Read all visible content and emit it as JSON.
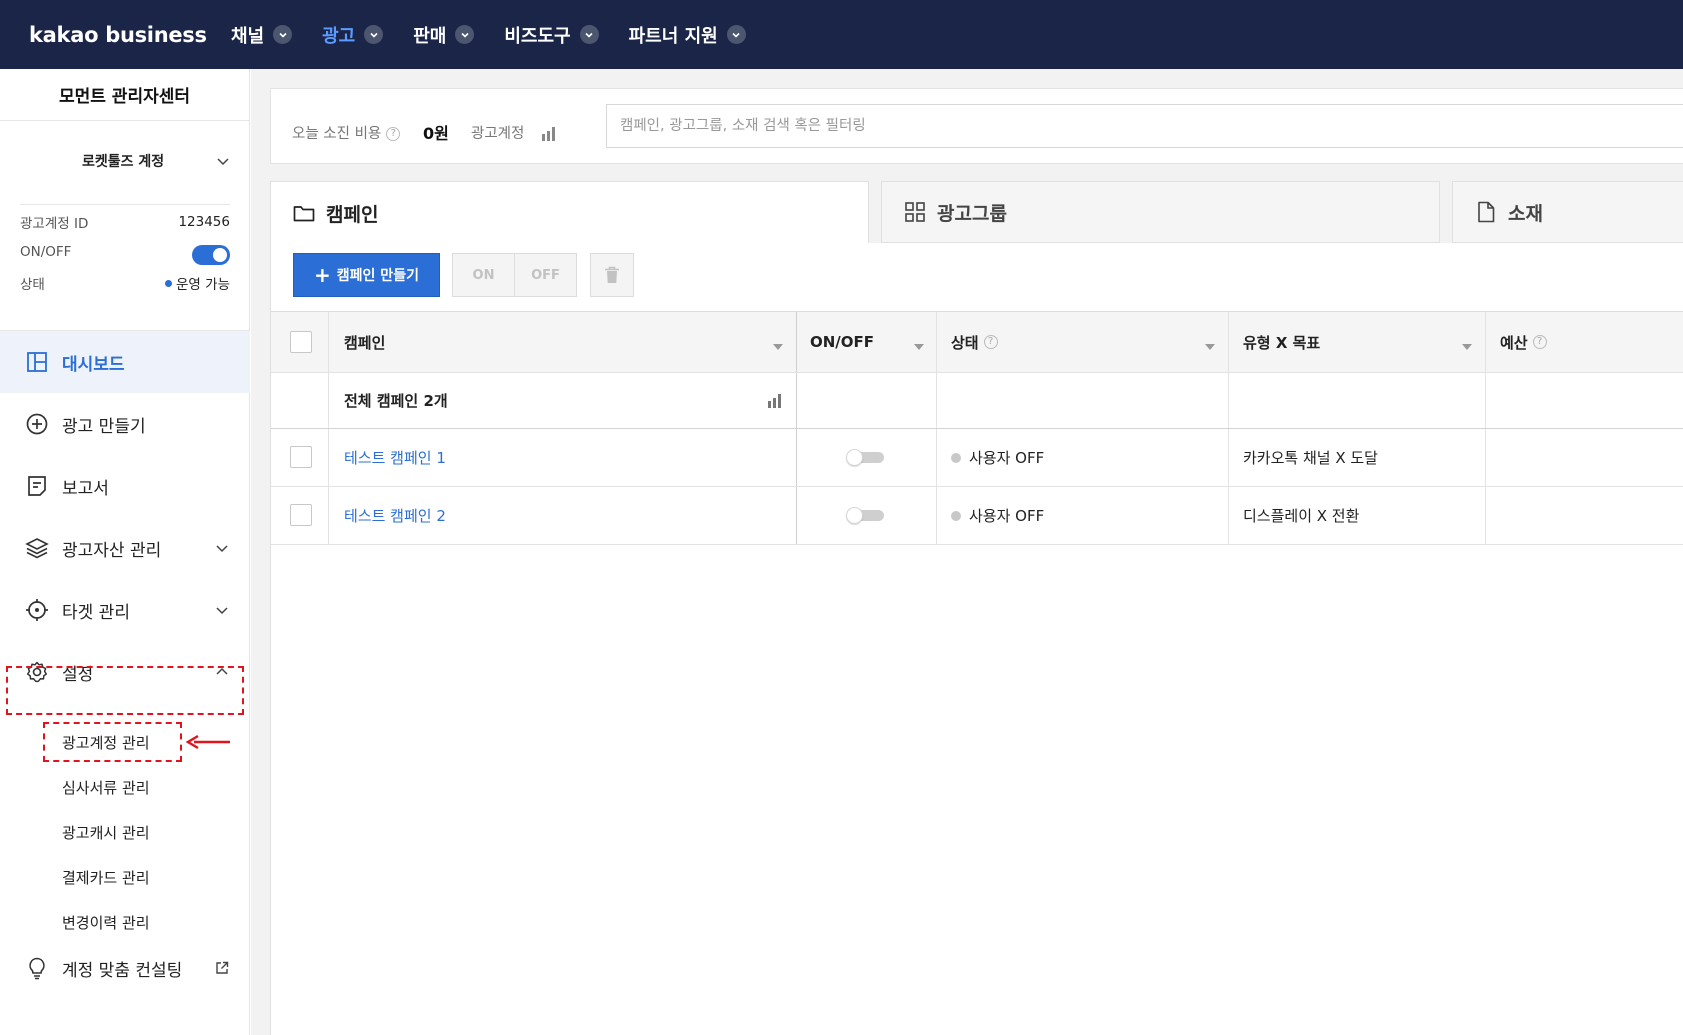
{
  "brand": {
    "logo": "kakao business"
  },
  "topnav": {
    "items": [
      {
        "label": "채널",
        "active": false
      },
      {
        "label": "광고",
        "active": true
      },
      {
        "label": "판매",
        "active": false
      },
      {
        "label": "비즈도구",
        "active": false
      },
      {
        "label": "파트너 지원",
        "active": false
      }
    ]
  },
  "sidebar": {
    "title": "모먼트 관리자센터",
    "account": {
      "name": "로켓툴즈 계정",
      "id_label": "광고계정 ID",
      "id_value": "123456",
      "onoff_label": "ON/OFF",
      "onoff_value": true,
      "status_label": "상태",
      "status_value": "운영 가능"
    },
    "menu": [
      {
        "label": "대시보드",
        "icon": "dashboard-icon",
        "active": true
      },
      {
        "label": "광고 만들기",
        "icon": "plus-circle-icon"
      },
      {
        "label": "보고서",
        "icon": "report-icon"
      },
      {
        "label": "광고자산 관리",
        "icon": "layers-icon",
        "expandable": true
      },
      {
        "label": "타겟 관리",
        "icon": "target-icon",
        "expandable": true
      },
      {
        "label": "설정",
        "icon": "gear-icon",
        "expanded": true
      }
    ],
    "settings_submenu": [
      {
        "label": "광고계정 관리"
      },
      {
        "label": "심사서류 관리"
      },
      {
        "label": "광고캐시 관리"
      },
      {
        "label": "결제카드 관리"
      },
      {
        "label": "변경이력 관리"
      }
    ],
    "consulting": {
      "label": "계정 맞춤 컨설팅",
      "icon": "lightbulb-icon"
    }
  },
  "summary": {
    "today_cost_label": "오늘 소진 비용",
    "today_cost_value": "0원",
    "account_label": "광고계정",
    "search_placeholder": "캠페인, 광고그룹, 소재 검색 혹은 필터링"
  },
  "tabs": [
    {
      "label": "캠페인",
      "icon": "folder-icon",
      "active": true
    },
    {
      "label": "광고그룹",
      "icon": "grid-icon",
      "active": false
    },
    {
      "label": "소재",
      "icon": "document-icon",
      "active": false
    }
  ],
  "toolbar": {
    "create_label": "캠페인 만들기",
    "on_label": "ON",
    "off_label": "OFF"
  },
  "table": {
    "columns": [
      "캠페인",
      "ON/OFF",
      "상태",
      "유형 X 목표",
      "예산"
    ],
    "total_label": "전체 캠페인 2개",
    "rows": [
      {
        "name": "테스트 캠페인 1",
        "onoff": false,
        "status": "사용자 OFF",
        "type_goal": "카카오톡 채널 X 도달"
      },
      {
        "name": "테스트 캠페인 2",
        "onoff": false,
        "status": "사용자 OFF",
        "type_goal": "디스플레이 X 전환"
      }
    ]
  },
  "colors": {
    "topnav_bg": "#1b2547",
    "accent": "#2b6fd6",
    "highlight": "#e0141c"
  }
}
